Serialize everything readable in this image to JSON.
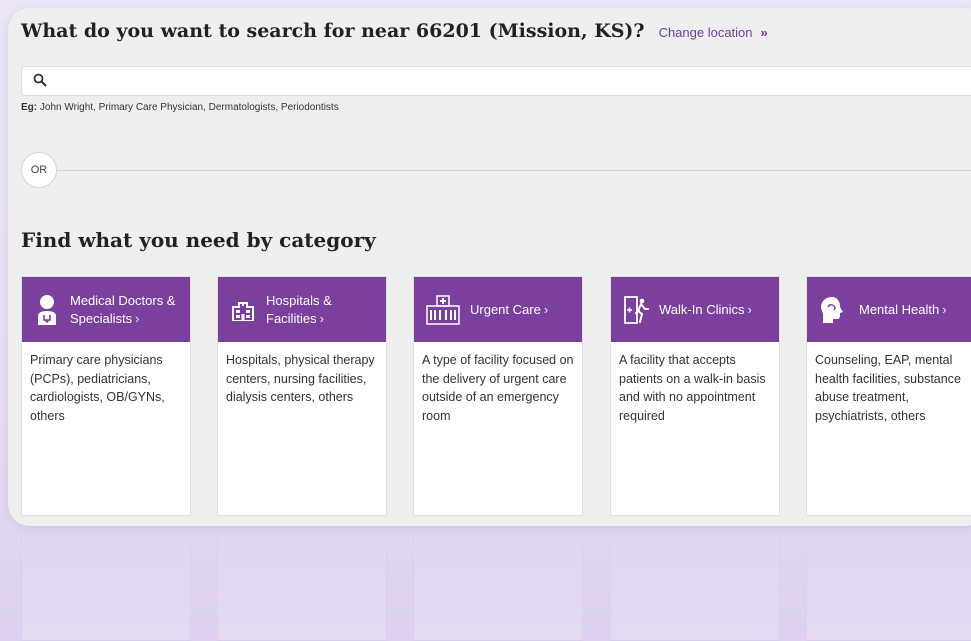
{
  "search_heading": "What do you want to search for near 66201 (Mission, KS)?",
  "change_location": {
    "label": "Change location",
    "chevron": "»"
  },
  "search": {
    "value": "",
    "placeholder": ""
  },
  "example": {
    "prefix": "Eg:",
    "text": " John Wright, Primary Care Physician, Dermatologists, Periodontists"
  },
  "or_label": "OR",
  "category_heading": "Find what you need by category",
  "categories": [
    {
      "icon": "doctor-icon",
      "title": "Medical Doctors & Specialists",
      "description": "Primary care physicians (PCPs), pediatricians, cardiologists, OB/GYNs, others"
    },
    {
      "icon": "hospital-icon",
      "title": "Hospitals & Facilities",
      "description": "Hospitals, physical therapy centers, nursing facilities, dialysis centers, others"
    },
    {
      "icon": "urgent-care-icon",
      "title": "Urgent Care",
      "description": "A type of facility focused on the delivery of urgent care outside of an emergency room"
    },
    {
      "icon": "walk-in-icon",
      "title": "Walk-In Clinics",
      "description": "A facility that accepts patients on a walk-in basis and with no appointment required"
    },
    {
      "icon": "mental-health-icon",
      "title": "Mental Health",
      "description": "Counseling, EAP, mental health facilities, substance abuse treatment, psychiatrists, others"
    }
  ],
  "colors": {
    "brand": "#7b3f9e",
    "link": "#6e3f9e",
    "panel": "#efefef"
  }
}
